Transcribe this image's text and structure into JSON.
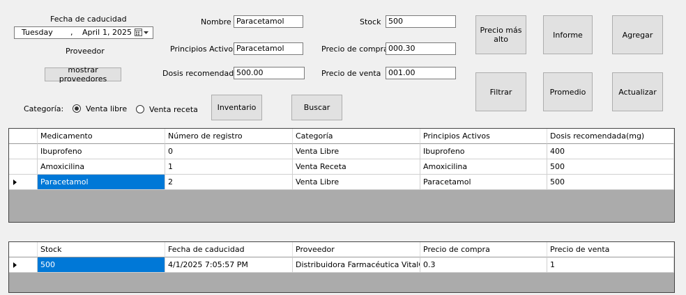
{
  "left": {
    "expiry_label": "Fecha de caducidad",
    "date": {
      "weekday": "Tuesday",
      "sep": ",",
      "month": "April",
      "day_year": "1, 2025"
    },
    "provider_label": "Proveedor",
    "show_providers_button": "mostrar proveedores"
  },
  "fields": {
    "nombre_label": "Nombre",
    "nombre_value": "Paracetamol",
    "principios_label": "Principios Activos",
    "principios_value": "Paracetamol",
    "dosis_label": "Dosis recomendada",
    "dosis_value": "500.00",
    "stock_label": "Stock",
    "stock_value": "500",
    "compra_label": "Precio de compra",
    "compra_value": "000.30",
    "venta_label": "Precio de venta",
    "venta_value": "001.00"
  },
  "category": {
    "label": "Categoría:",
    "options": [
      "Venta libre",
      "Venta receta"
    ],
    "selected": "Venta libre"
  },
  "buttons": {
    "inventario": "Inventario",
    "buscar": "Buscar",
    "precio_alto": "Precio más alto",
    "informe": "Informe",
    "agregar": "Agregar",
    "filtrar": "Filtrar",
    "promedio": "Promedio",
    "actualizar": "Actualizar"
  },
  "medicines_table": {
    "columns": [
      "Medicamento",
      "Número de registro",
      "Categoría",
      "Principios Activos",
      "Dosis recomendada(mg)"
    ],
    "rows": [
      [
        "Ibuprofeno",
        "0",
        "Venta Libre",
        "Ibuprofeno",
        "400"
      ],
      [
        "Amoxicilina",
        "1",
        "Venta Receta",
        "Amoxicilina",
        "500"
      ],
      [
        "Paracetamol",
        "2",
        "Venta Libre",
        "Paracetamol",
        "500"
      ]
    ],
    "current_row": 2
  },
  "stock_table": {
    "columns": [
      "Stock",
      "Fecha de caducidad",
      "Proveedor",
      "Precio de compra",
      "Precio de venta"
    ],
    "rows": [
      [
        "500",
        "4/1/2025 7:05:57 PM",
        "Distribuidora Farmacéutica VitalCare",
        "0.3",
        "1"
      ]
    ],
    "current_row": 0
  },
  "colors": {
    "selection": "#0078d7",
    "button": "#e1e1e1",
    "empty_grid": "#ababab"
  }
}
